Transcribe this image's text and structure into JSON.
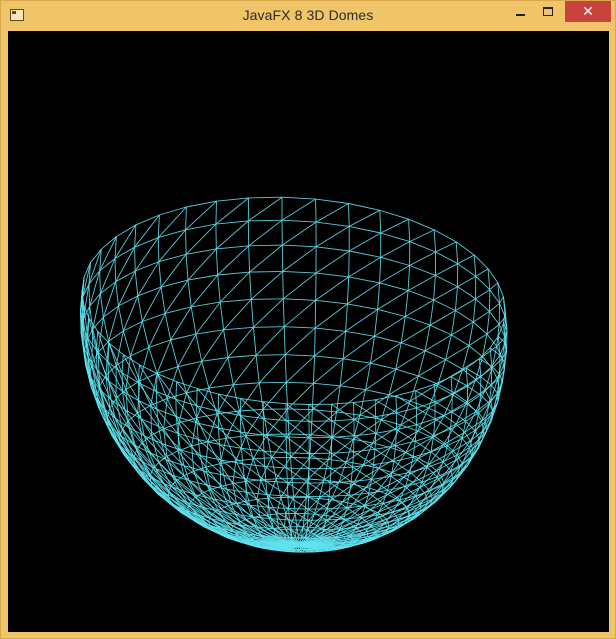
{
  "window": {
    "title": "JavaFX 8 3D Domes",
    "controls": {
      "minimize_icon": "minimize-icon",
      "maximize_icon": "maximize-icon",
      "close_glyph": "✕"
    }
  },
  "scene": {
    "background": "#000000",
    "mesh_color": "#5fe3f0",
    "shape": "dome-wireframe"
  },
  "colors": {
    "titlebar": "#f0c468",
    "close_button": "#c7433c"
  }
}
